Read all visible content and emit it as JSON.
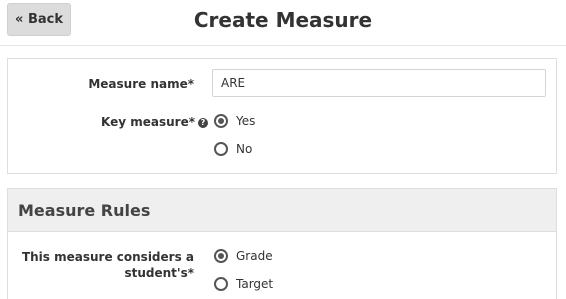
{
  "header": {
    "back_label": "« Back",
    "title": "Create Measure"
  },
  "form": {
    "measure_name_label": "Measure name*",
    "measure_name_value": "ARE",
    "key_measure_label": "Key measure*",
    "key_measure_help_icon": "question-circle-icon",
    "key_measure_options": [
      {
        "label": "Yes",
        "checked": true
      },
      {
        "label": "No",
        "checked": false
      }
    ]
  },
  "rules": {
    "section_title": "Measure Rules",
    "considers_label_line1": "This measure considers a",
    "considers_label_line2": "student's*",
    "considers_options": [
      {
        "label": "Grade",
        "checked": true
      },
      {
        "label": "Target",
        "checked": false
      }
    ]
  },
  "colors": {
    "back_button_bg": "#dcdcdc",
    "section_header_bg": "#efefef",
    "border": "#dedede"
  }
}
